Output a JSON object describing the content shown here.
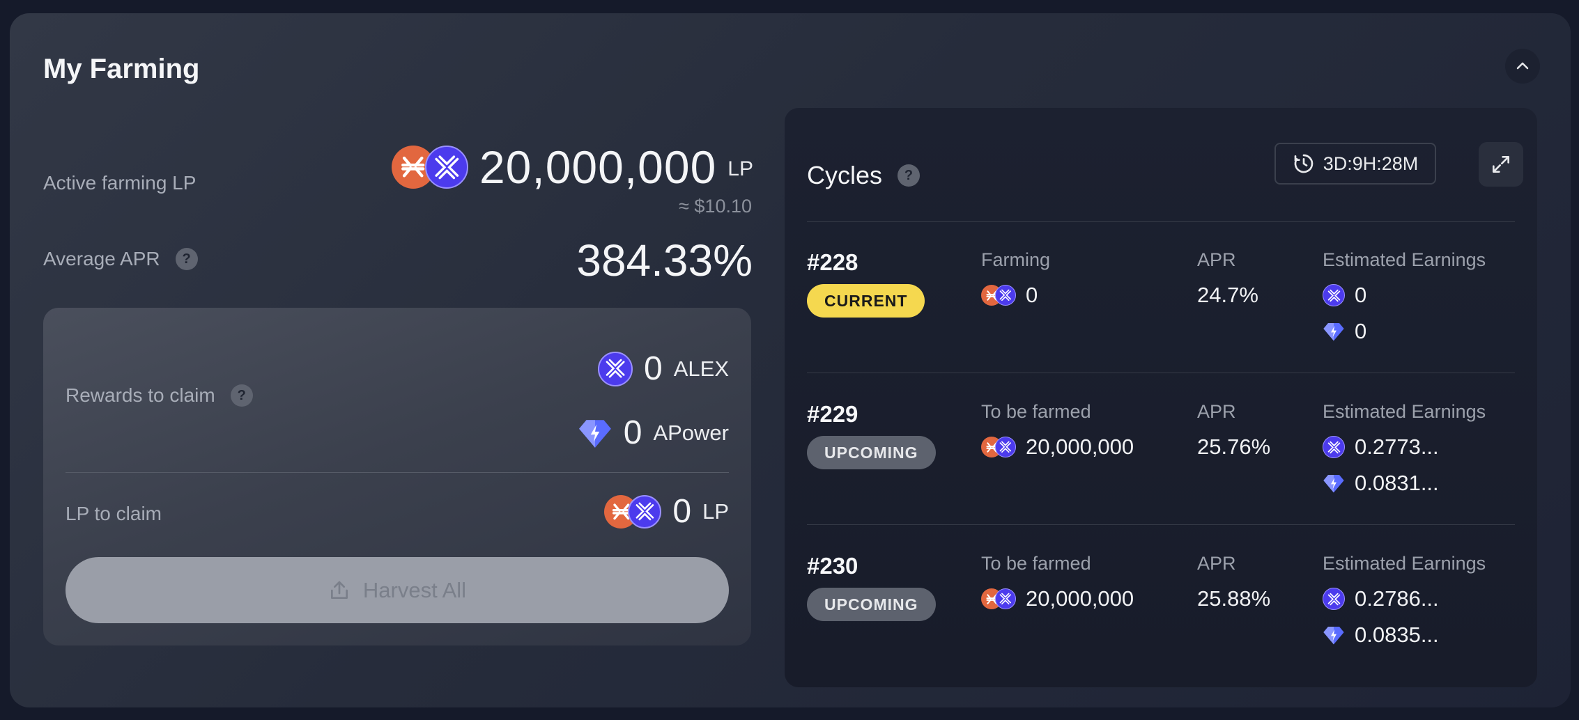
{
  "header": {
    "title": "My Farming"
  },
  "summary": {
    "active_label": "Active farming LP",
    "active_value": "20,000,000",
    "active_unit": "LP",
    "active_usd": "≈ $10.10",
    "apr_label": "Average APR",
    "apr_value": "384.33%"
  },
  "rewards": {
    "label": "Rewards to claim",
    "alex_amount": "0",
    "alex_symbol": "ALEX",
    "apower_amount": "0",
    "apower_symbol": "APower",
    "lp_label": "LP to claim",
    "lp_amount": "0",
    "lp_unit": "LP",
    "harvest_label": "Harvest All"
  },
  "cycles": {
    "title": "Cycles",
    "timer": "3D:9H:28M",
    "apr_header": "APR",
    "earn_header": "Estimated Earnings",
    "rows": [
      {
        "id": "#228",
        "badge": "CURRENT",
        "farm_label": "Farming",
        "farm_value": "0",
        "apr": "24.7%",
        "earn_alex": "0",
        "earn_apower": "0"
      },
      {
        "id": "#229",
        "badge": "UPCOMING",
        "farm_label": "To be farmed",
        "farm_value": "20,000,000",
        "apr": "25.76%",
        "earn_alex": "0.2773...",
        "earn_apower": "0.0831..."
      },
      {
        "id": "#230",
        "badge": "UPCOMING",
        "farm_label": "To be farmed",
        "farm_value": "20,000,000",
        "apr": "25.88%",
        "earn_alex": "0.2786...",
        "earn_apower": "0.0835..."
      }
    ]
  },
  "colors": {
    "stx": "#e2673f",
    "alex": "#4c3bed",
    "current_badge": "#f5d84f",
    "upcoming_badge": "#5d626e"
  }
}
